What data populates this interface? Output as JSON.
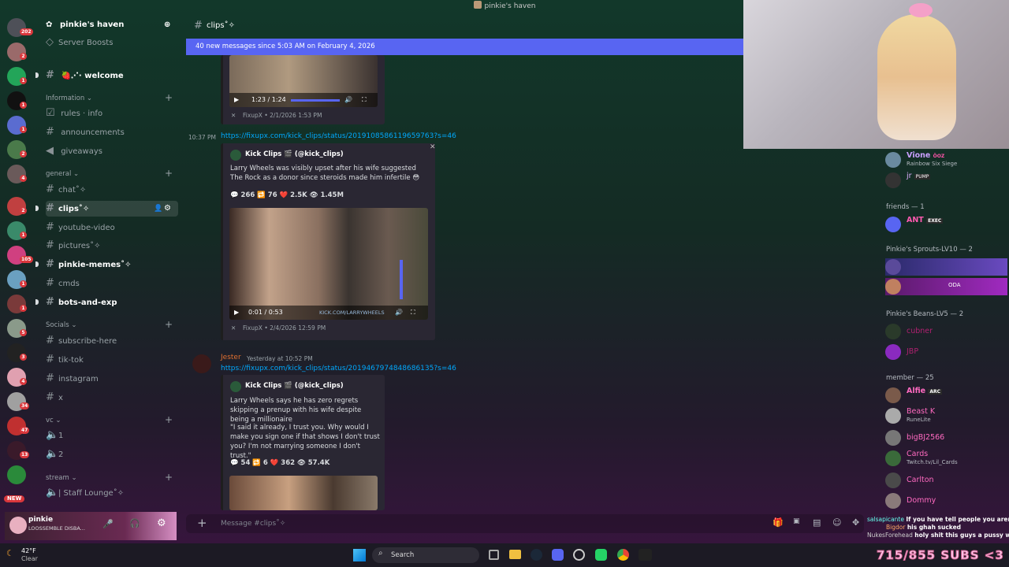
{
  "window_title": "pinkie's haven",
  "servers": [
    {
      "badge": "202"
    },
    {
      "badge": "2"
    },
    {
      "badge": "1"
    },
    {
      "badge": "1"
    },
    {
      "badge": "1"
    },
    {
      "badge": "2"
    },
    {
      "badge": "4"
    },
    {
      "badge": "2"
    },
    {
      "badge": "1"
    },
    {
      "badge": "105"
    },
    {
      "badge": "1"
    },
    {
      "badge": "1"
    },
    {
      "badge": "5"
    },
    {
      "badge": "3"
    },
    {
      "badge": "4"
    },
    {
      "badge": "34"
    },
    {
      "badge": "47"
    },
    {
      "badge": "13"
    },
    {
      "badge": "NEW"
    }
  ],
  "guild": {
    "name": "pinkie's haven",
    "boosts": "Server Boosts"
  },
  "channels": {
    "welcome": "welcome",
    "welcome_emoji": "🍓⋰·",
    "cat_information": "Information",
    "rules": "rules · info",
    "announcements": "announcements",
    "giveaways": "giveaways",
    "cat_general": "general",
    "chat": "chat˚✧",
    "clips": "clips˚✧",
    "youtube": "youtube-video",
    "pictures": "pictures˚✧",
    "memes": "pinkie-memes˚✧",
    "cmds": "cmds",
    "bots": "bots-and-exp",
    "cat_socials": "Socials",
    "subscribe": "subscribe-here",
    "tiktok": "tik-tok",
    "instagram": "instagram",
    "x": "x",
    "cat_vc": "vc",
    "vc1": "1",
    "vc2": "2",
    "cat_stream": "stream",
    "staff": "| Staff Lounge˚✧"
  },
  "user": {
    "name": "pinkie",
    "status": "LOOSSEMBLE DISBA..."
  },
  "chat": {
    "channel": "clips˚✧",
    "new_messages": "40 new messages since 5:03 AM on February 4, 2026",
    "msg1": {
      "time_top": "1:23 / 1:24",
      "footer": "FixupX • 2/1/2026 1:53 PM"
    },
    "msg2": {
      "timestamp": "10:37 PM",
      "link": "https://fixupx.com/kick_clips/status/2019108586119659763?s=46",
      "author": "Kick Clips 🎬 (@kick_clips)",
      "text": "Larry Wheels was visibly upset after his wife suggested The Rock as a donor since steroids made him infertile 😳",
      "stats": "💬 266  🔁 76  ❤️ 2.5K  👁 1.45M",
      "video_time": "0:01 / 0:53",
      "watermark": "KICK.COM/LARRYWHEELS",
      "footer": "FixupX • 2/4/2026 12:59 PM"
    },
    "msg3": {
      "author": "Jester",
      "timestamp": "Yesterday at 10:52 PM",
      "link": "https://fixupx.com/kick_clips/status/2019467974848686135?s=46",
      "embed_author": "Kick Clips 🎬 (@kick_clips)",
      "text1": "Larry Wheels says he has zero regrets skipping a prenup with his wife despite being a millionaire",
      "text2": "\"I said it already, I trust you. Why would I make you sign one if that shows I don't trust you? I'm not marrying someone I don't trust.\"",
      "stats": "💬 54  🔁 6  ❤️ 362  👁 57.4K"
    },
    "composer_placeholder": "Message #clips˚✧"
  },
  "members": {
    "top": [
      {
        "name": "Vîone",
        "tag": "ÖOZ",
        "sub": "Rainbow Six Siege",
        "color": "#c9a0ff"
      },
      {
        "name": "jr",
        "tag": "PUMP",
        "sub": "",
        "color": "#e0b0ff"
      }
    ],
    "friends_label": "friends — 1",
    "friends": [
      {
        "name": "ANT",
        "tag": "EXEC",
        "color": "#ff5ab0"
      }
    ],
    "sprouts_label": "Pinkie's Sprouts-LV10 — 2",
    "sprouts": [
      {
        "name": "",
        "tag": ""
      },
      {
        "name": "",
        "tag": "ODA"
      }
    ],
    "beans_label": "Pinkie's Beans-LV5 — 2",
    "beans": [
      {
        "name": "cubner",
        "color": "#b02070"
      },
      {
        "name": "JBP",
        "color": "#b02070"
      }
    ],
    "member_label": "member — 25",
    "list": [
      {
        "name": "Alfie",
        "tag": "ARC",
        "sub": "",
        "color": "#ff6ac1"
      },
      {
        "name": "Beast K",
        "tag": "",
        "sub": "RuneLite",
        "color": "#ff6ac1"
      },
      {
        "name": "bigBJ2566",
        "tag": "",
        "sub": "",
        "color": "#ff6ac1"
      },
      {
        "name": "Cards",
        "tag": "",
        "sub": "Twitch.tv/Lil_Cards",
        "color": "#ff6ac1"
      },
      {
        "name": "Carlton",
        "tag": "",
        "sub": "",
        "color": "#ff6ac1"
      },
      {
        "name": "Dommy",
        "tag": "",
        "sub": "",
        "color": "#ff6ac1"
      }
    ]
  },
  "stream_chat": [
    {
      "user": "salsapicante",
      "msg": "If you have tell people you aren't a cuck you are likely a cuck"
    },
    {
      "user": "Bigdor",
      "msg": "his ghah sucked"
    },
    {
      "user": "NukesForehead",
      "msg": "holy shit this guys a pussy with"
    }
  ],
  "taskbar": {
    "weather_temp": "42°F",
    "weather_desc": "Clear",
    "search": "Search",
    "overlay_text": "715/855 SUBS <3"
  }
}
